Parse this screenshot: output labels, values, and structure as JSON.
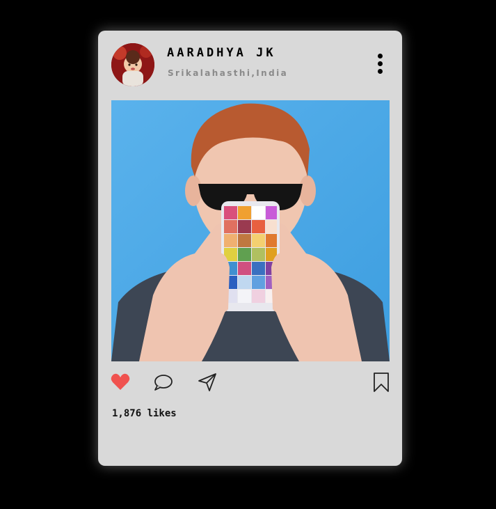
{
  "post": {
    "username": "AARADHYA JK",
    "location": "Srikalahasthi,India",
    "likes": "1,876 likes"
  },
  "colors": {
    "card_bg": "#d9d9d9",
    "heart": "#f0524f",
    "page_bg": "#000000"
  },
  "icons": {
    "more": "more-vertical-icon",
    "like": "heart-icon",
    "comment": "comment-icon",
    "share": "send-icon",
    "save": "bookmark-icon"
  }
}
